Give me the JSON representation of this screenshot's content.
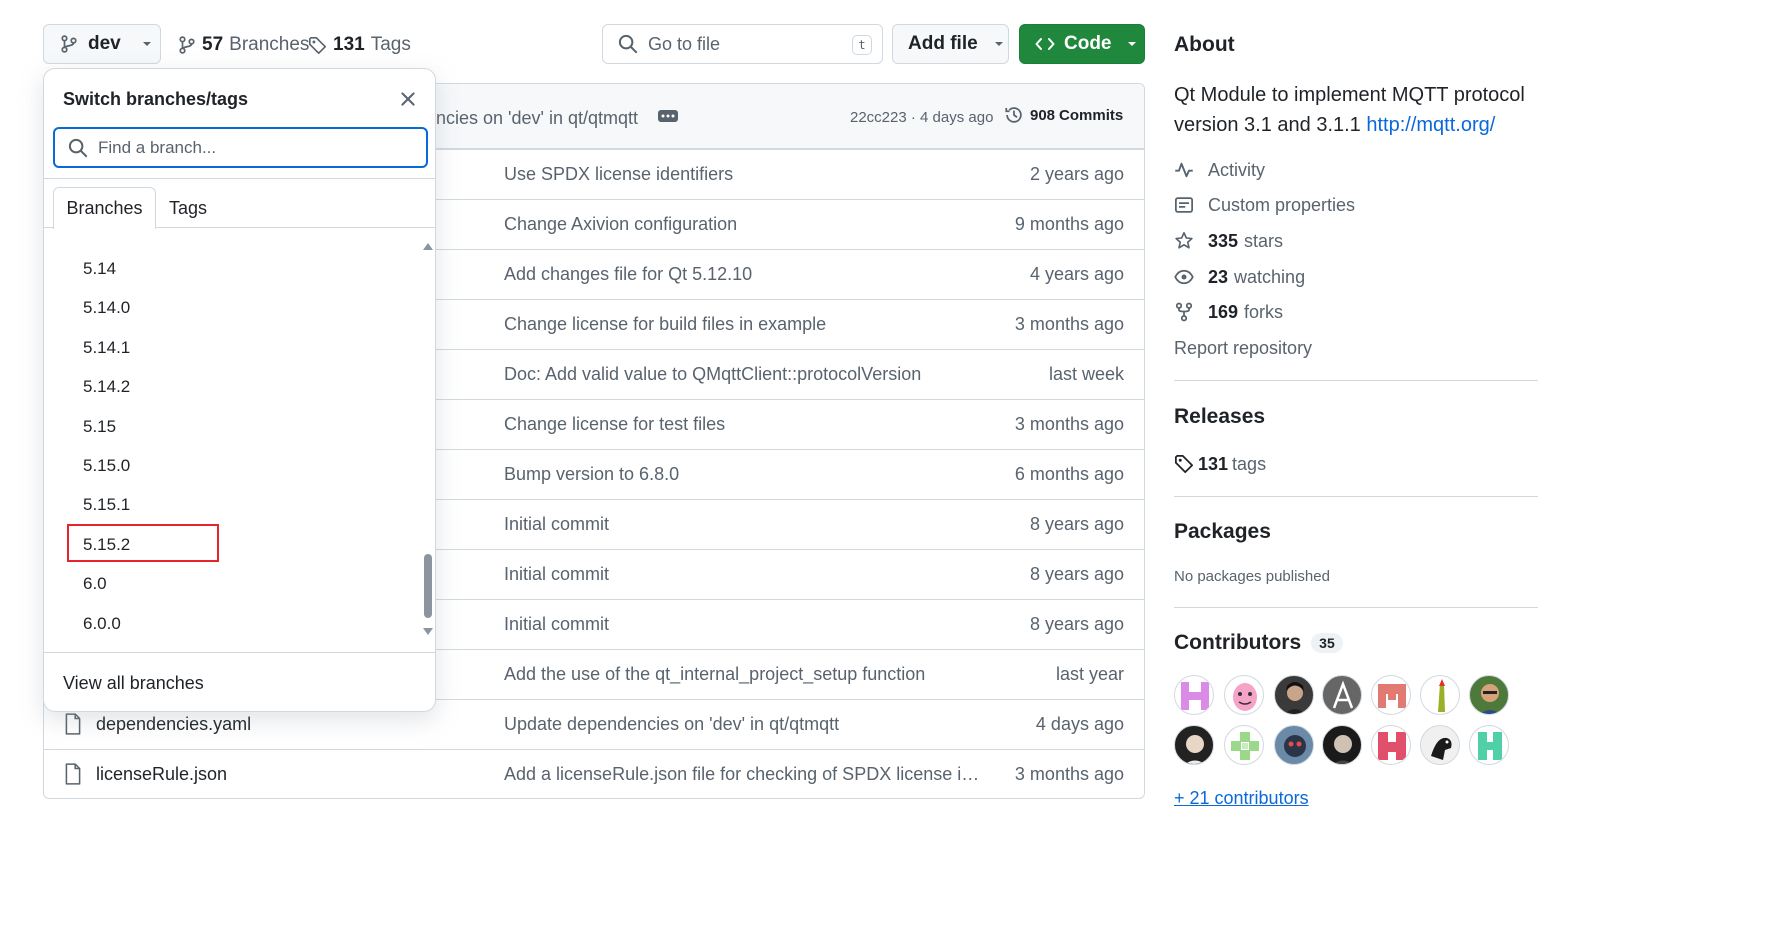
{
  "toolbar": {
    "branch_button_label": "dev",
    "branches_count": "57",
    "branches_label": "Branches",
    "tags_count": "131",
    "tags_label": "Tags",
    "goto_placeholder": "Go to file",
    "goto_shortcut": "t",
    "add_file_label": "Add file",
    "code_label": "Code"
  },
  "commit_header": {
    "message": "ncies on 'dev' in qt/qtmqtt",
    "sha_time": "22cc223 · 4 days ago",
    "commits_count": "908",
    "commits_label": "Commits"
  },
  "files": [
    {
      "name": "",
      "message": "Use SPDX license identifiers",
      "when": "2 years ago"
    },
    {
      "name": "",
      "message": "Change Axivion configuration",
      "when": "9 months ago"
    },
    {
      "name": "",
      "message": "Add changes file for Qt 5.12.10",
      "when": "4 years ago"
    },
    {
      "name": "",
      "message": "Change license for build files in example",
      "when": "3 months ago"
    },
    {
      "name": "",
      "message": "Doc: Add valid value to QMqttClient::protocolVersion",
      "when": "last week"
    },
    {
      "name": "",
      "message": "Change license for test files",
      "when": "3 months ago"
    },
    {
      "name": "",
      "message": "Bump version to 6.8.0",
      "when": "6 months ago"
    },
    {
      "name": "",
      "message": "Initial commit",
      "when": "8 years ago"
    },
    {
      "name": "",
      "message": "Initial commit",
      "when": "8 years ago"
    },
    {
      "name": "",
      "message": "Initial commit",
      "when": "8 years ago"
    },
    {
      "name": "",
      "message": "Add the use of the qt_internal_project_setup function",
      "when": "last year"
    },
    {
      "name": "dependencies.yaml",
      "message": "Update dependencies on 'dev' in qt/qtmqtt",
      "when": "4 days ago"
    },
    {
      "name": "licenseRule.json",
      "message": "Add a licenseRule.json file for checking of SPDX license ident…",
      "when": "3 months ago"
    }
  ],
  "dropdown": {
    "title": "Switch branches/tags",
    "search_placeholder": "Find a branch...",
    "tab_branches": "Branches",
    "tab_tags": "Tags",
    "branches": [
      "5.14",
      "5.14.0",
      "5.14.1",
      "5.14.2",
      "5.15",
      "5.15.0",
      "5.15.1",
      "5.15.2",
      "6.0",
      "6.0.0"
    ],
    "highlighted_branch": "5.15.2",
    "view_all": "View all branches"
  },
  "about": {
    "heading": "About",
    "description": "Qt Module to implement MQTT protocol version 3.1 and 3.1.1",
    "link": "http://mqtt.org/",
    "activity": "Activity",
    "custom_properties": "Custom properties",
    "stars_count": "335",
    "stars_label": "stars",
    "watching_count": "23",
    "watching_label": "watching",
    "forks_count": "169",
    "forks_label": "forks",
    "report": "Report repository"
  },
  "releases": {
    "heading": "Releases",
    "tags_count": "131",
    "tags_label": "tags"
  },
  "packages": {
    "heading": "Packages",
    "text": "No packages published"
  },
  "contributors": {
    "heading": "Contributors",
    "count": "35",
    "more": "+ 21 contributors"
  },
  "colors": {
    "accent_green": "#1f883d",
    "link_blue": "#0969da",
    "highlight_red": "#e5252a"
  }
}
